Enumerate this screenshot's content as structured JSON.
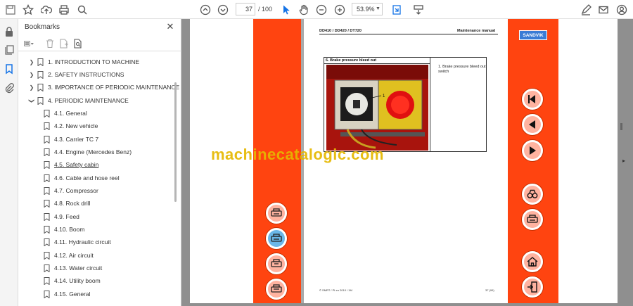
{
  "toolbar": {
    "page_current": "37",
    "page_total": "/ 100",
    "zoom": "53.9%",
    "icons": [
      "save-icon",
      "star-icon",
      "upload-icon",
      "print-icon",
      "zoom-search-icon",
      "page-up-icon",
      "page-down-icon",
      "select-cursor-icon",
      "hand-icon",
      "zoom-out-icon",
      "zoom-in-icon",
      "fit-page-icon",
      "scroll-mode-icon",
      "sign-icon",
      "mail-icon",
      "account-icon"
    ]
  },
  "panel": {
    "title": "Bookmarks",
    "items": [
      {
        "label": "1. INTRODUCTION TO MACHINE",
        "level": 0,
        "expand": "collapsed"
      },
      {
        "label": "2. SAFETY INSTRUCTIONS",
        "level": 0,
        "expand": "collapsed"
      },
      {
        "label": "3. IMPORTANCE OF PERIODIC MAINTENANCE",
        "level": 0,
        "expand": "collapsed"
      },
      {
        "label": "4. PERIODIC MAINTENANCE",
        "level": 0,
        "expand": "expanded"
      },
      {
        "label": "4.1. General",
        "level": 1
      },
      {
        "label": "4.2. New vehicle",
        "level": 1
      },
      {
        "label": "4.3. Carrier TC 7",
        "level": 1
      },
      {
        "label": "4.4. Engine (Mercedes Benz)",
        "level": 1
      },
      {
        "label": "4.5. Safety cabin",
        "level": 1,
        "highlight": true
      },
      {
        "label": "4.6. Cable and hose reel",
        "level": 1
      },
      {
        "label": "4.7. Compressor",
        "level": 1
      },
      {
        "label": "4.8. Rock drill",
        "level": 1
      },
      {
        "label": "4.9. Feed",
        "level": 1
      },
      {
        "label": "4.10. Boom",
        "level": 1
      },
      {
        "label": "4.11. Hydraulic circuit",
        "level": 1
      },
      {
        "label": "4.12. Air circuit",
        "level": 1
      },
      {
        "label": "4.13. Water circuit",
        "level": 1
      },
      {
        "label": "4.14. Utility boom",
        "level": 1
      },
      {
        "label": "4.15. General",
        "level": 1
      }
    ]
  },
  "document": {
    "header_left": "DD410 / DD420 / DT720",
    "header_right": "Maintenance manual",
    "box_title": "6. Brake pressure bleed out",
    "box_note": "1.   Brake      pressure bleed out switch",
    "callout": "1",
    "footer_left": "© SMRT / PI en 2010 / 1M",
    "footer_right": "37 (99)",
    "brand": "SANDVIK",
    "accent_color": "#ff4410"
  },
  "watermark": "machinecatalogic.com"
}
